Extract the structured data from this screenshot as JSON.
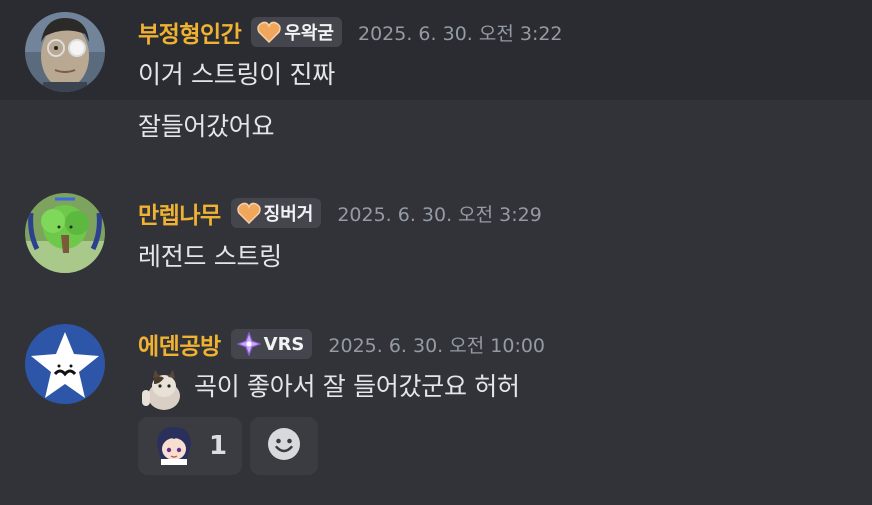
{
  "messages": [
    {
      "username": "부정형인간",
      "tag": "우왁굳",
      "timestamp": "2025. 6. 30. 오전 3:22",
      "lines": [
        "이거 스트링이 진짜",
        "잘들어갔어요"
      ]
    },
    {
      "username": "만렙나무",
      "tag": "징버거",
      "timestamp": "2025. 6. 30. 오전 3:29",
      "lines": [
        "레전드 스트링"
      ]
    },
    {
      "username": "에덴공방",
      "tag": "VRS",
      "timestamp": "2025. 6. 30. 오전 10:00",
      "lines": [
        "곡이 좋아서 잘 들어갔군요 허허"
      ]
    }
  ],
  "reactions": [
    {
      "emoji": "anime-character-emoji",
      "count": "1"
    },
    {
      "emoji": "add-reaction-smiley-icon"
    }
  ],
  "colors": {
    "background": "#323339",
    "hover_background": "#2b2c31",
    "username": "#f0b232",
    "timestamp": "#949ba4",
    "text": "#e3e5e8",
    "tag_background": "#45464d"
  }
}
